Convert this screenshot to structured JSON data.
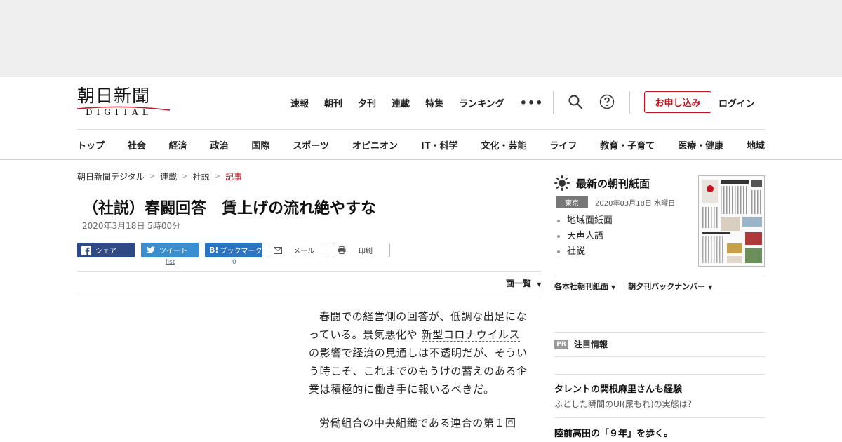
{
  "header": {
    "logo_main": "朝日新聞",
    "logo_sub": "DIGITAL",
    "top_nav": [
      "速報",
      "朝刊",
      "夕刊",
      "連載",
      "特集",
      "ランキング"
    ],
    "more_label": "•••",
    "signup_label": "お申し込み",
    "login_label": "ログイン",
    "categories": [
      "トップ",
      "社会",
      "経済",
      "政治",
      "国際",
      "スポーツ",
      "オピニオン",
      "IT・科学",
      "文化・芸能",
      "ライフ",
      "教育・子育て",
      "医療・健康",
      "地域"
    ]
  },
  "breadcrumb": {
    "items": [
      "朝日新聞デジタル",
      "連載",
      "社説"
    ],
    "current": "記事",
    "separator": ">"
  },
  "article": {
    "title": "（社説）春闘回答　賃上げの流れ絶やすな",
    "date": "2020年3月18日 5時00分",
    "share": {
      "facebook": "シェア",
      "twitter": "ツイート",
      "twitter_count": "list",
      "hatena_badge": "B!",
      "hatena": "ブックマーク",
      "hatena_count": "0",
      "mail": "メール",
      "print": "印刷"
    },
    "menu_label": "面一覧",
    "p1_before": "春闘での経営側の回答が、低調な出足になっている。景気悪化や ",
    "p1_link": "新型コロナウイルス",
    "p1_after": " の影響で経済の見通しは不透明だが、そういう時こそ、これまでのもうけの蓄えのある企業は積極的に働き手に報いるべきだ。",
    "p2": "労働組合の中央組織である連合の第１回"
  },
  "sidebar": {
    "title": "最新の朝刊紙面",
    "region": "東京",
    "paper_date": "2020年03月18日 水曜日",
    "links": [
      "地域面紙面",
      "天声人語",
      "社説"
    ],
    "dropdowns": [
      "各本社朝刊紙面",
      "朝夕刊バックナンバー"
    ],
    "pr_badge": "PR",
    "pr_label": "注目情報",
    "pr_items": [
      {
        "title": "タレントの関根麻里さんも経験",
        "desc": "ふとした瞬間のUI(尿もれ)の実態は？"
      },
      {
        "title": "陸前高田の「９年」を歩く。",
        "desc": ""
      }
    ]
  },
  "colors": {
    "brand_red": "#c4111d",
    "facebook": "#2d4a86",
    "twitter": "#3a8ed0",
    "hatena": "#2a74c3"
  },
  "icons": [
    "search-icon",
    "help-icon",
    "sun-icon",
    "facebook-icon",
    "twitter-icon",
    "mail-icon",
    "print-icon"
  ]
}
